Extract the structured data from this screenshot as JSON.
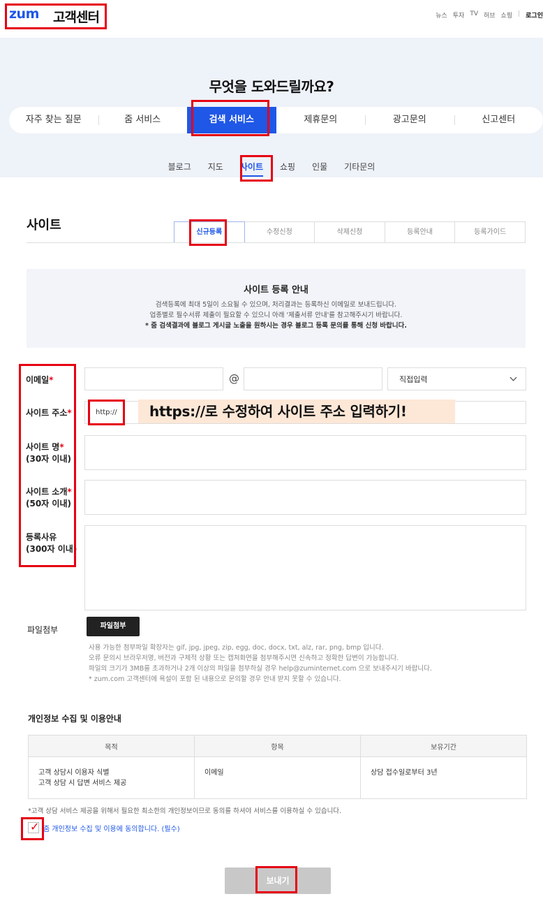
{
  "header": {
    "logo": "zum",
    "logo_sub": "고객센터",
    "topnav": [
      "뉴스",
      "투자",
      "TV",
      "허브",
      "쇼핑"
    ],
    "login": "로그인"
  },
  "hero": {
    "title": "무엇을 도와드릴까요?",
    "main_tabs": [
      "자주 찾는 질문",
      "줌 서비스",
      "검색 서비스",
      "제휴문의",
      "광고문의",
      "신고센터"
    ],
    "sub_tabs": [
      "블로그",
      "지도",
      "사이트",
      "쇼핑",
      "인물",
      "기타문의"
    ]
  },
  "section": {
    "title": "사이트",
    "reg_tabs": [
      "신규등록",
      "수정신청",
      "삭제신청",
      "등록안내",
      "등록가이드"
    ]
  },
  "notice": {
    "title": "사이트 등록 안내",
    "lines": [
      "검색등록에 최대 5일이 소요될 수 있으며, 처리결과는 등록하신 이메일로 보내드립니다.",
      "업종별로 필수서류 제출이 필요할 수 있으니 아래 '제출서류 안내'를 참고해주시기 바랍니다.",
      "* 줌 검색결과에 블로그 게시글 노출을 원하시는 경우 블로그 등록 문의를 통해 신청 바랍니다."
    ]
  },
  "form": {
    "email_label": "이메일",
    "at": "@",
    "domain_select": "직접입력",
    "url_label": "사이트 주소",
    "url_prefix": "http://",
    "annotation": "https://로 수정하여 사이트 주소 입력하기!",
    "name_label": "사이트 명",
    "name_hint": "(30자 이내)",
    "intro_label": "사이트 소개",
    "intro_hint": "(50자 이내)",
    "reason_label": "등록사유",
    "reason_hint": "(300자 이내)",
    "req_mark": "*",
    "attach_label": "파일첨부",
    "attach_button": "파일첨부",
    "attach_notes": [
      "사용 가능한 첨부파일 확장자는 gif, jpg, jpeg, zip, egg, doc, docx, txt, alz, rar, png, bmp 입니다.",
      "오류 문의시 브라우저명, 버전과 구체적 상황 또는 캡쳐화면을 첨부해주시면 신속하고 정확한 답변이 가능합니다.",
      "파일의 크기가 3MB를 초과하거나 2개 이상의 파일을 첨부하실 경우 help@zuminternet.com 으로 보내주시기 바랍니다.",
      "* zum.com 고객센터에 욕설이 포함 된 내용으로 문의할 경우 안내 받지 못할 수 있습니다."
    ]
  },
  "privacy": {
    "title": "개인정보 수집 및 이용안내",
    "headers": [
      "목적",
      "항목",
      "보유기간"
    ],
    "purpose_lines": [
      "고객 상담시 이용자 식별",
      "고객 상담 시 답변 서비스 제공"
    ],
    "item": "이메일",
    "period": "상담 접수일로부터 3년",
    "note": "*고객 상담 서비스 제공을 위해서 필요한 최소한의 개인정보이므로 동의를 하셔야 서비스를 이용하실 수 있습니다.",
    "agree": "줌 개인정보 수집 및 이용에 동의합니다. (필수)"
  },
  "submit": "보내기",
  "colors": {
    "accent": "#1f57e7",
    "highlight": "#e60012",
    "annotation_bg": "#fde7d7"
  }
}
